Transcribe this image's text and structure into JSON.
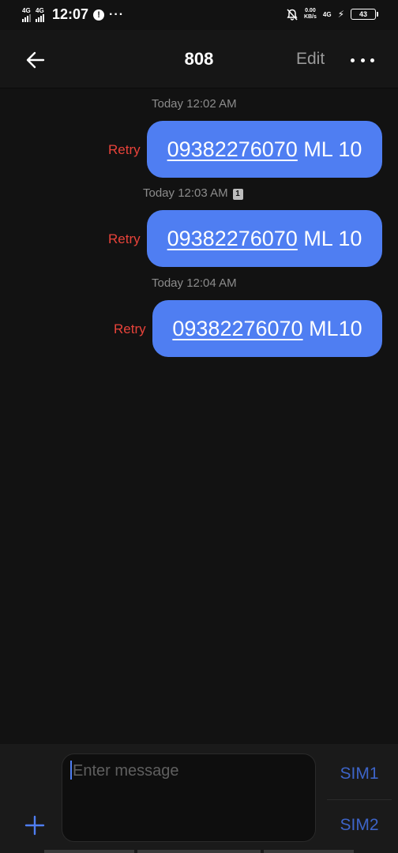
{
  "status_bar": {
    "sim1_network": "4G",
    "sim2_network": "4G",
    "time": "12:07",
    "alert_glyph": "!",
    "more_glyph": "···",
    "speed_value": "0.00",
    "speed_unit": "KB/s",
    "data_network": "4G",
    "battery": "43"
  },
  "header": {
    "title": "808",
    "edit_label": "Edit"
  },
  "messages": [
    {
      "timestamp": "Today 12:02 AM",
      "sim_badge": "",
      "retry_label": "Retry",
      "number": "09382276070",
      "text": " ML 10"
    },
    {
      "timestamp": "Today 12:03 AM",
      "sim_badge": "1",
      "retry_label": "Retry",
      "number": "09382276070",
      "text": " ML 10"
    },
    {
      "timestamp": "Today 12:04 AM",
      "sim_badge": "",
      "retry_label": "Retry",
      "number": "09382276070",
      "text": " ML10"
    }
  ],
  "composer": {
    "placeholder": "Enter message",
    "sim1_label": "SIM1",
    "sim2_label": "SIM2"
  },
  "colors": {
    "bubble": "#4f7ef2",
    "retry": "#e8433a",
    "sim_button": "#3d64c8",
    "background": "#121212"
  },
  "icons": {
    "back": "arrow-left-icon",
    "more": "more-horizontal-icon",
    "add": "plus-icon",
    "alert": "alert-circle-icon",
    "mute": "bell-off-icon",
    "charging": "bolt-icon",
    "battery": "battery-icon"
  }
}
